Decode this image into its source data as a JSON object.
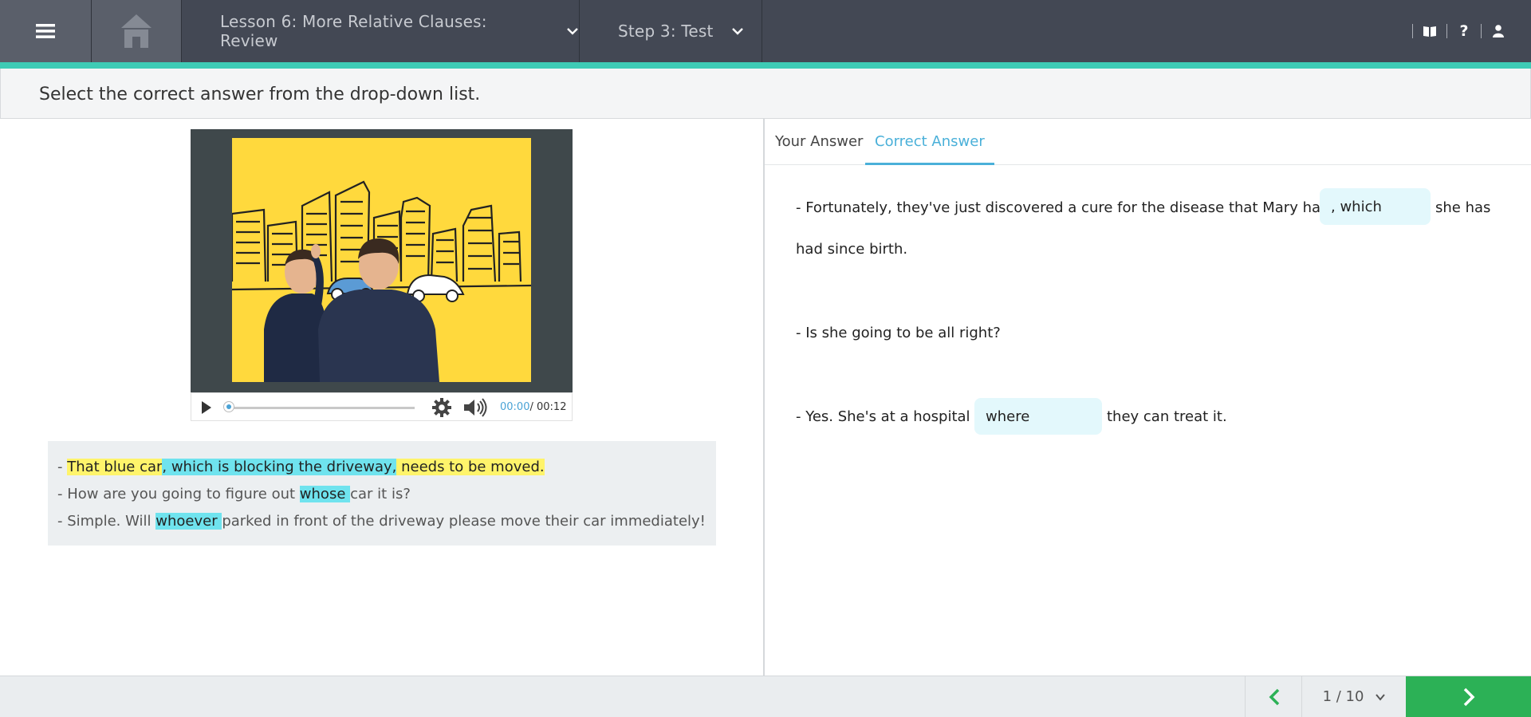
{
  "header": {
    "lesson_title": "Lesson 6: More Relative Clauses: Review",
    "step_title": "Step 3: Test",
    "icons": [
      "menu-icon",
      "home-icon",
      "book-icon",
      "help-icon",
      "user-icon"
    ],
    "help_label": "?"
  },
  "instruction": "Select the correct answer from the drop-down list.",
  "video": {
    "current_time": "00:00",
    "separator": "/",
    "total_time": "00:12",
    "progress": 0
  },
  "transcript": {
    "line1": {
      "prefix": "- ",
      "part1": "That blue car",
      "part2": ", which is blocking the driveway,",
      "part3": " needs to be moved."
    },
    "line2": {
      "before": "- How are you going to figure out ",
      "highlight": "whose ",
      "after": "car it is?"
    },
    "line3": {
      "before": "- Simple. Will ",
      "highlight": "whoever ",
      "after": "parked in front of the driveway please move their car immediately!"
    }
  },
  "tabs": {
    "your_answer": "Your Answer",
    "correct_answer": "Correct Answer",
    "active": "correct_answer"
  },
  "questions": {
    "q1_before": "- Fortunately, they've just discovered a cure for the disease that Mary has",
    "q1_answer": ", which",
    "q1_after": "she has",
    "q1_cont": "had since birth.",
    "q2": "- Is she going to be all right?",
    "q3_before": "- Yes. She's at a hospital",
    "q3_answer": "where",
    "q3_after": "they can treat it."
  },
  "footer": {
    "page": "1 / 10"
  },
  "colors": {
    "topbar": "#434854",
    "accent": "#3ecbb5",
    "highlight_yellow": "#fff46b",
    "highlight_cyan": "#6fe3ee",
    "tab_active": "#4ab0d9",
    "next_button": "#2cb156"
  }
}
